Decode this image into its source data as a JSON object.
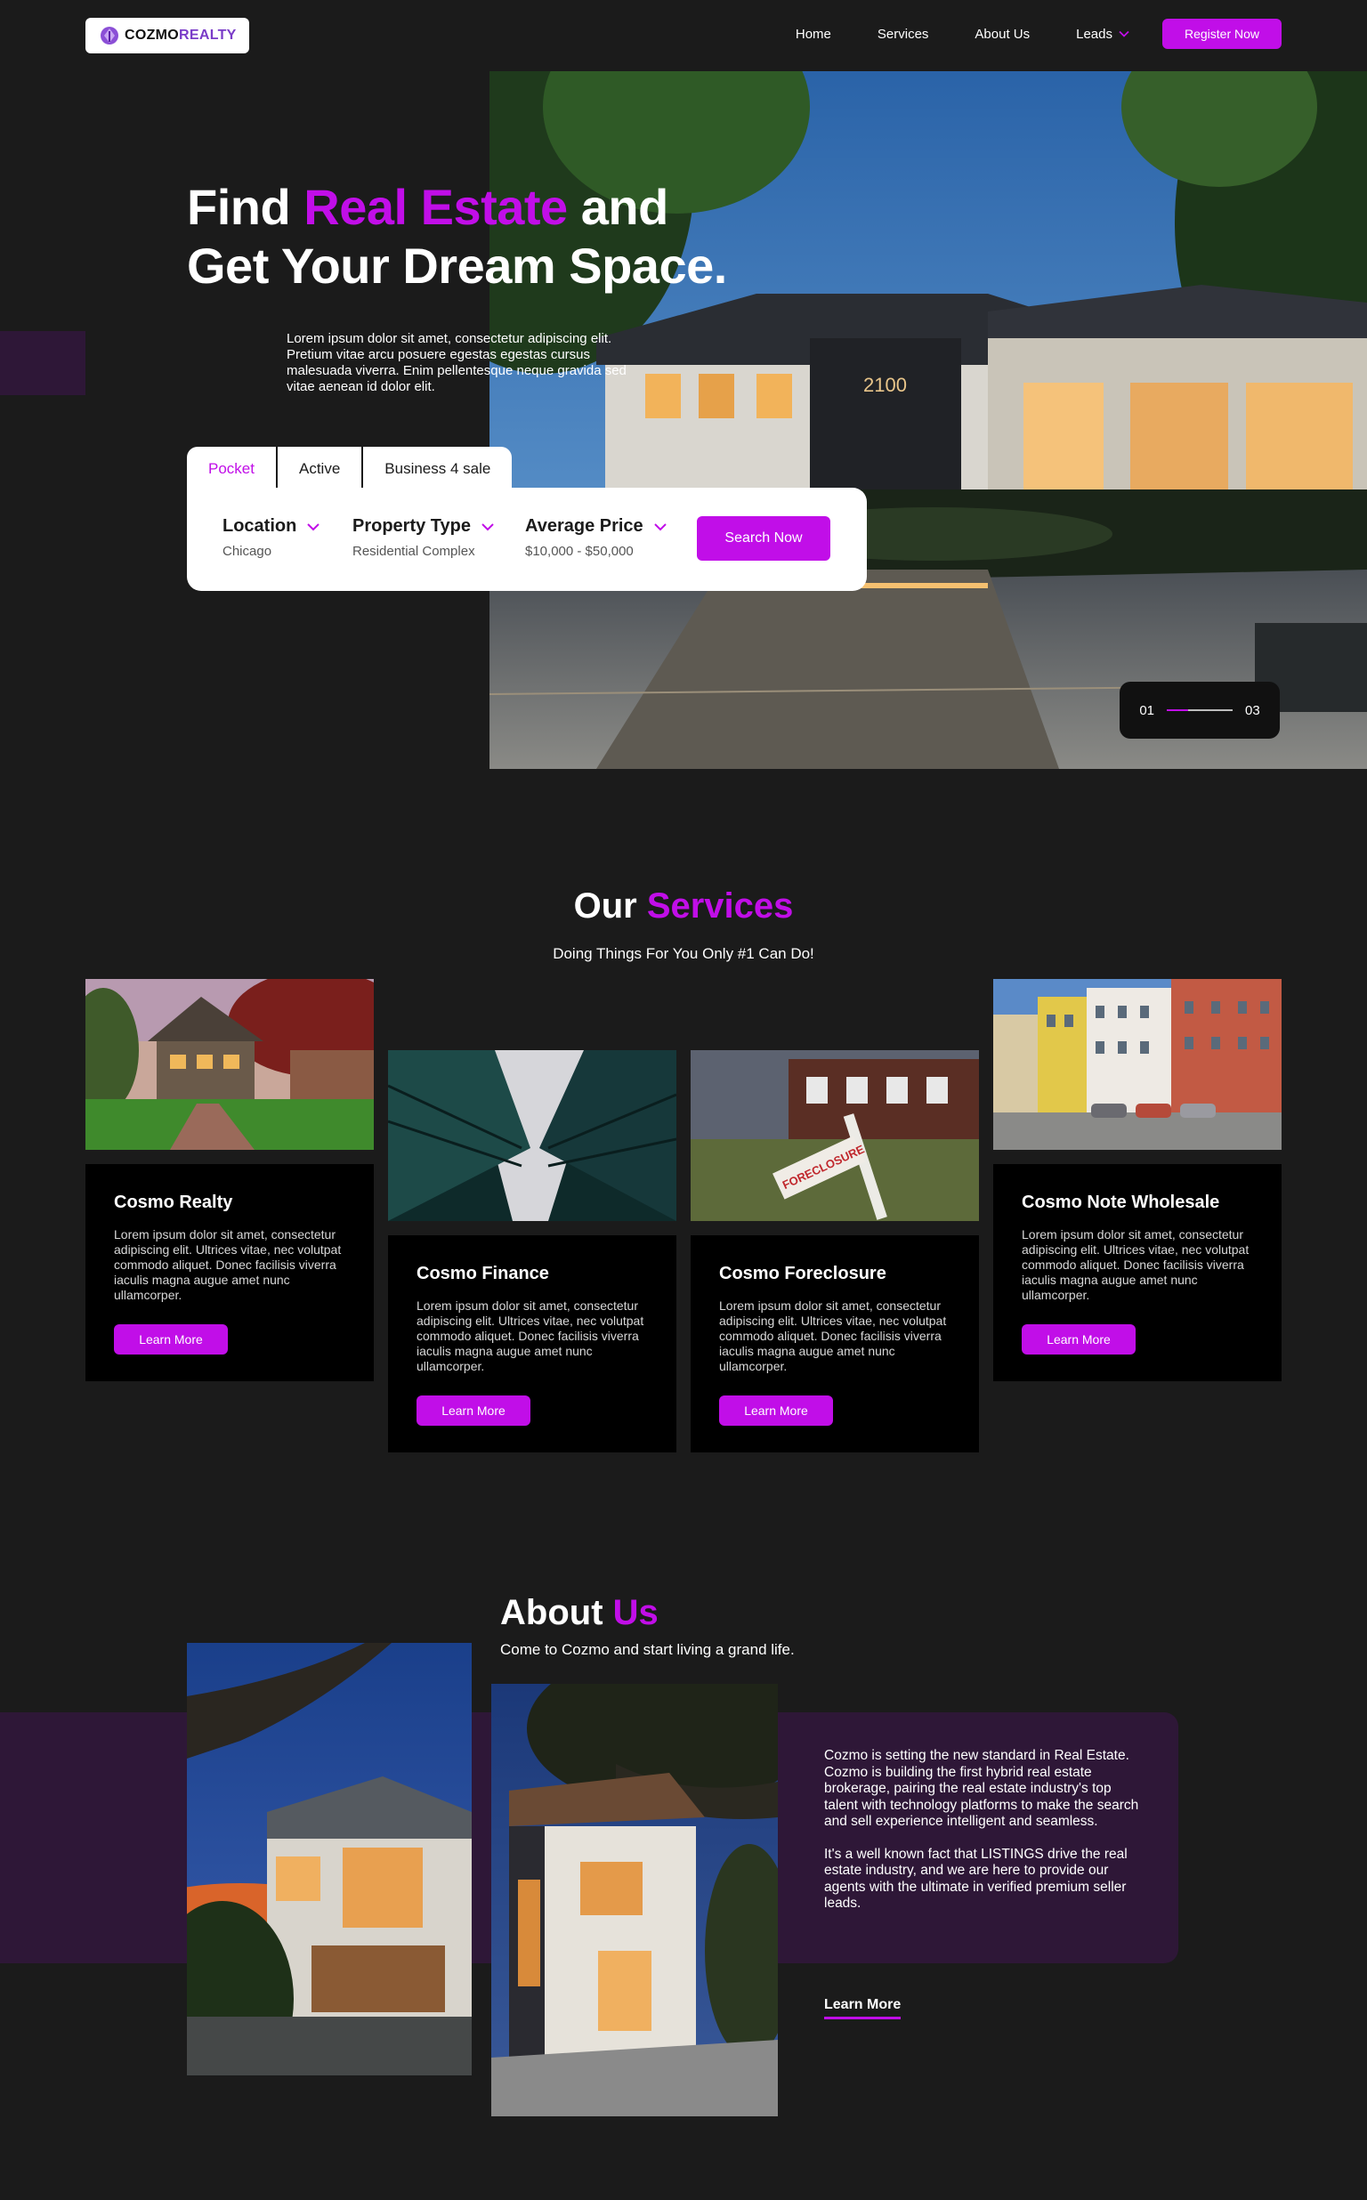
{
  "colors": {
    "accent": "#c10ee8",
    "background": "#1b1b1b",
    "card": "#000000",
    "band": "#2e1737"
  },
  "brand": {
    "logo_icon": "house-drop-icon",
    "word1": "COZMO",
    "word2": "REALTY"
  },
  "nav": {
    "links": [
      "Home",
      "Services",
      "About Us"
    ],
    "leads": "Leads",
    "register": "Register Now"
  },
  "hero": {
    "title_1": "Find ",
    "title_accent": "Real Estate",
    "title_2": " and",
    "title_line2": "Get Your Dream Space.",
    "description": "Lorem ipsum dolor sit amet, consectetur adipiscing elit. Pretium vitae arcu posuere egestas egestas cursus malesuada viverra. Enim pellentesque neque gravida sed vitae aenean id dolor elit.",
    "tabs": [
      "Pocket",
      "Active",
      "Business 4 sale"
    ],
    "active_tab": 0,
    "filters": [
      {
        "label": "Location",
        "value": "Chicago"
      },
      {
        "label": "Property Type",
        "value": "Residential Complex"
      },
      {
        "label": "Average Price",
        "value": "$10,000 - $50,000"
      }
    ],
    "search_button": "Search Now",
    "slider": {
      "current": "01",
      "total": "03",
      "progress": 0.33
    }
  },
  "services": {
    "title_1": "Our ",
    "title_accent": "Services",
    "subtitle": "Doing Things For You Only #1 Can Do!",
    "cards": [
      {
        "title": "Cosmo Realty",
        "text": "Lorem ipsum dolor sit amet, consectetur adipiscing elit. Ultrices vitae, nec volutpat commodo aliquet. Donec facilisis viverra iaculis magna augue amet nunc ullamcorper.",
        "button": "Learn More"
      },
      {
        "title": "Cosmo Finance",
        "text": "Lorem ipsum dolor sit amet, consectetur adipiscing elit. Ultrices vitae, nec volutpat commodo aliquet. Donec facilisis viverra iaculis magna augue amet nunc ullamcorper.",
        "button": "Learn More"
      },
      {
        "title": "Cosmo Foreclosure",
        "text": "Lorem ipsum dolor sit amet, consectetur adipiscing elit. Ultrices vitae, nec volutpat commodo aliquet. Donec facilisis viverra iaculis magna augue amet nunc ullamcorper.",
        "button": "Learn More"
      },
      {
        "title": "Cosmo Note Wholesale",
        "text": "Lorem ipsum dolor sit amet, consectetur adipiscing elit. Ultrices vitae, nec volutpat commodo aliquet. Donec facilisis viverra iaculis magna augue amet nunc ullamcorper.",
        "button": "Learn More"
      }
    ],
    "foreclosure_sign": "FORECLOSURE"
  },
  "about": {
    "title_1": "About ",
    "title_accent": "Us",
    "subtitle": "Come to Cozmo and start living a grand life.",
    "paragraph_1": "Cozmo is setting the new standard in Real Estate. Cozmo is building the first hybrid real estate brokerage, pairing the real estate industry's top talent with technology platforms to make the search and sell experience intelligent and seamless.",
    "paragraph_2": "It's a well known fact that LISTINGS drive the real estate industry, and we are here to provide our agents with the ultimate in verified premium seller leads.",
    "link": "Learn More"
  }
}
